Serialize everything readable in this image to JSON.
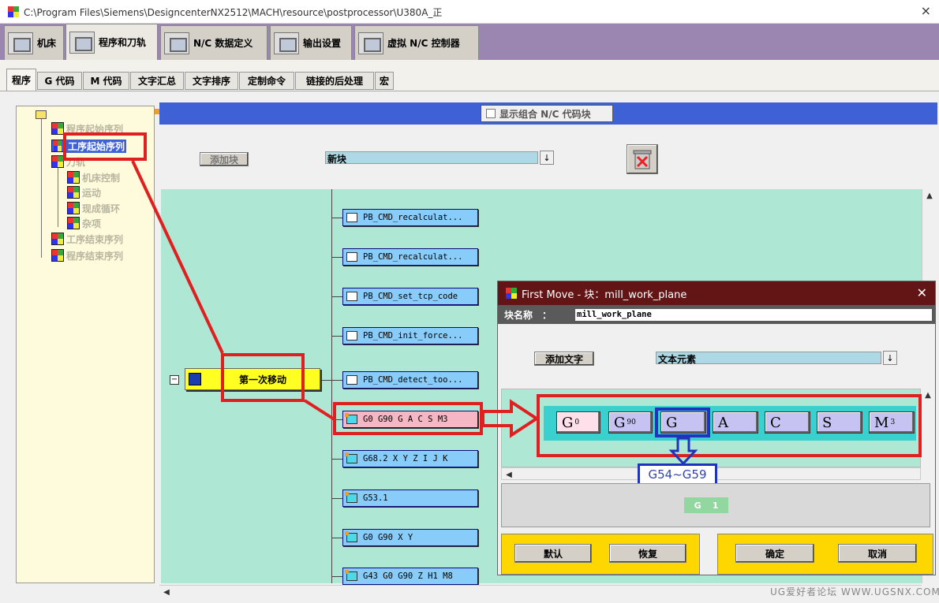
{
  "window": {
    "title": "C:\\Program Files\\Siemens\\DesigncenterNX2512\\MACH\\resource\\postprocessor\\U380A_正",
    "close_icon": "×"
  },
  "main_tabs": [
    "机床",
    "程序和刀轨",
    "N/C 数据定义",
    "输出设置",
    "虚拟 N/C 控制器"
  ],
  "sub_tabs": [
    "程序",
    "G 代码",
    "M 代码",
    "文字汇总",
    "文字排序",
    "定制命令",
    "链接的后处理",
    "宏"
  ],
  "tree": {
    "items": [
      "程序起始序列",
      "工序起始序列",
      "刀轨",
      "机床控制",
      "运动",
      "现成循环",
      "杂项",
      "工序结束序列",
      "程序结束序列"
    ]
  },
  "toolbar": {
    "show_combined": "显示组合 N/C 代码块",
    "add_block": "添加块",
    "new_block": "新块",
    "dropdown_icon": "↓"
  },
  "sequence": {
    "event": "第一次移动",
    "collapse": "−",
    "blocks": [
      "PB_CMD_recalculat...",
      "PB_CMD_recalculat...",
      "PB_CMD_set_tcp_code",
      "PB_CMD_init_force...",
      "PB_CMD_detect_too...",
      "G0 G90 G A C S M3",
      "G68.2 X Y Z I J K",
      "G53.1",
      "G0 G90 X Y",
      "G43 G0 G90 Z H1 M8"
    ]
  },
  "dialog": {
    "title": "First Move  -  块：mill_work_plane",
    "close_icon": "✕",
    "name_label": "块名称　：",
    "name_value": "mill_work_plane",
    "add_text": "添加文字",
    "text_element": "文本元素",
    "words": [
      {
        "letter": "G",
        "sub": "0"
      },
      {
        "letter": "G",
        "sub": "90"
      },
      {
        "letter": "G",
        "sub": ""
      },
      {
        "letter": "A",
        "sub": ""
      },
      {
        "letter": "C",
        "sub": ""
      },
      {
        "letter": "S",
        "sub": ""
      },
      {
        "letter": "M",
        "sub": "3"
      }
    ],
    "annotation": "G54~G59",
    "preview": [
      "G",
      "1"
    ],
    "buttons": {
      "default": "默认",
      "restore": "恢复",
      "ok": "确定",
      "cancel": "取消"
    }
  },
  "watermark": "UG爱好者论坛 WWW.UGSNX.COM",
  "colors": {
    "accent_blue": "#3e62d6",
    "annotation_red": "#e02020",
    "annotation_blue": "#2233bb",
    "dialog_title": "#631414",
    "canvas": "#afe7d5"
  }
}
